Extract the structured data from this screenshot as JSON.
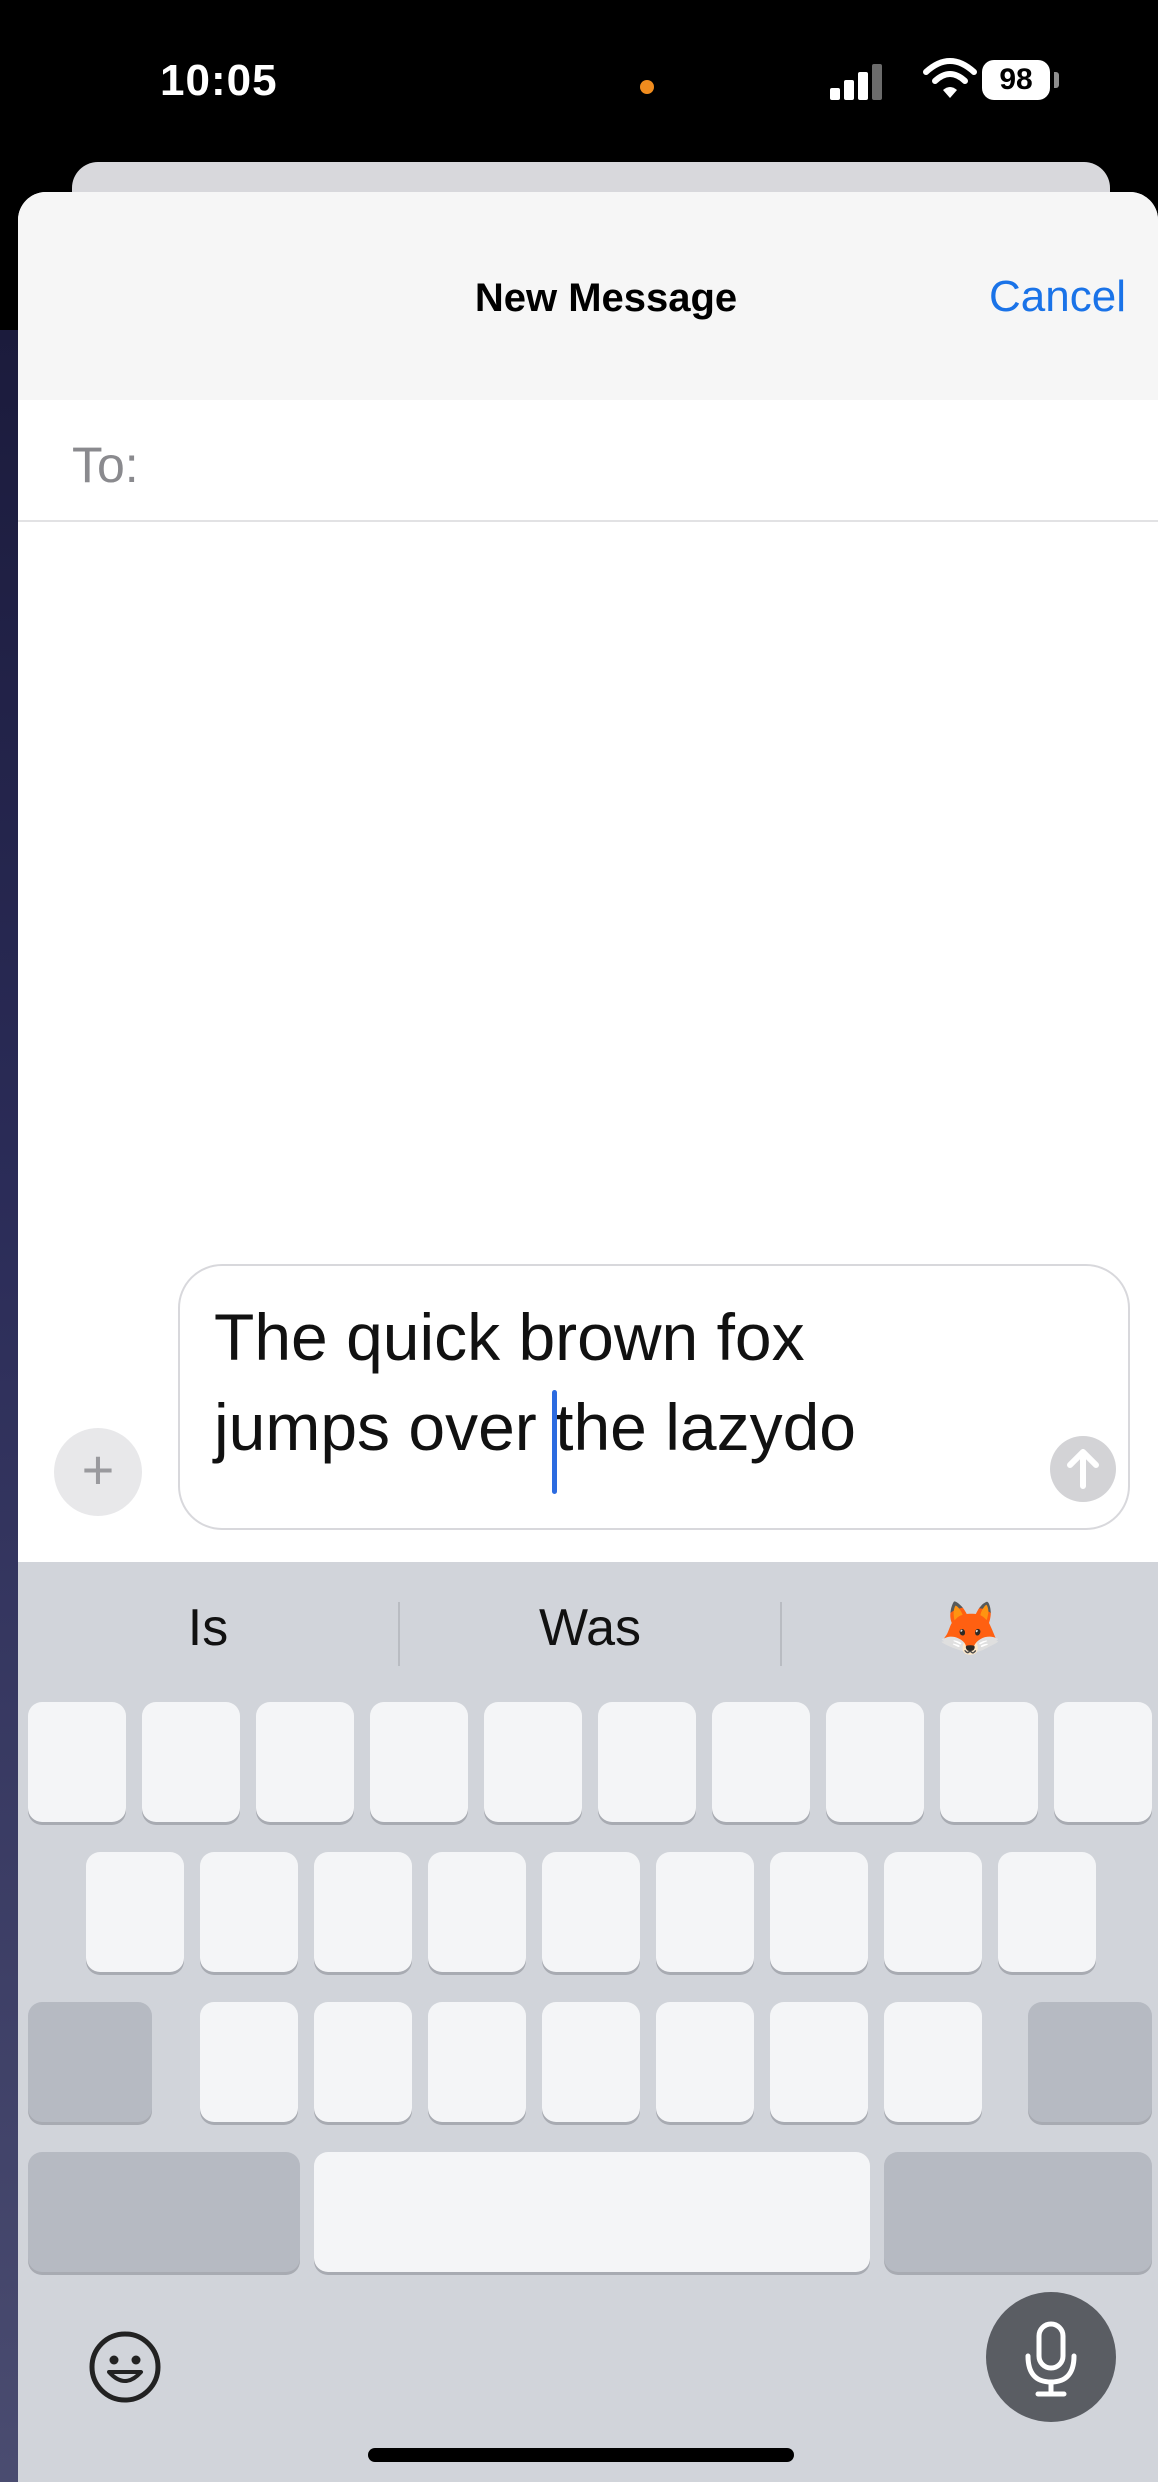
{
  "status_bar": {
    "time": "10:05",
    "battery": "98"
  },
  "nav": {
    "title": "New Message",
    "cancel_label": "Cancel"
  },
  "recipient": {
    "label": "To:"
  },
  "composer": {
    "line1": "The quick brown fox",
    "line2": "jumps over the lazydo"
  },
  "keyboard": {
    "suggestions": [
      "Is",
      "Was",
      "🦊"
    ]
  },
  "icons": [
    "plus-icon",
    "send-arrow-icon",
    "emoji-icon",
    "microphone-icon",
    "signal-icon",
    "wifi-icon",
    "battery-icon"
  ],
  "colors": {
    "accent": "#1a73e8",
    "caret": "#2c6be0",
    "keyboard_bg": "#d1d4da"
  }
}
